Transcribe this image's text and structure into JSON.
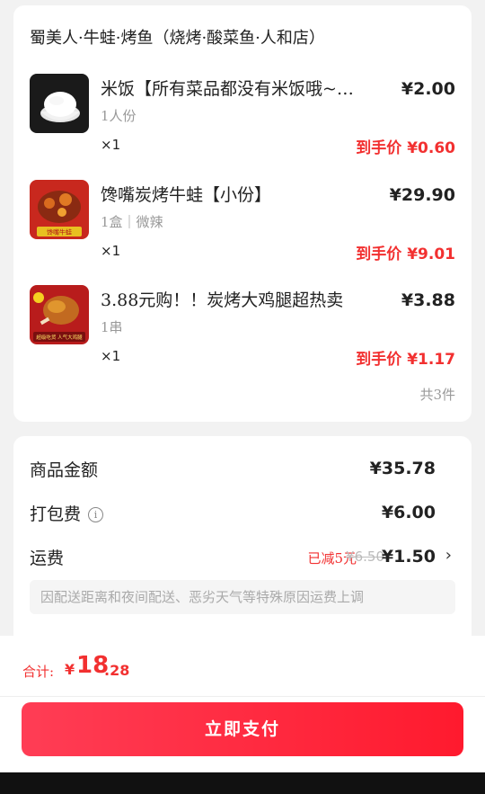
{
  "shop": {
    "name": "蜀美人·牛蛙·烤鱼（烧烤·酸菜鱼·人和店）",
    "items": [
      {
        "title": "米饭【所有菜品都没有米饭哦~…",
        "spec": "1人份",
        "price": "¥2.00",
        "qty": "×1",
        "final": "到手价 ¥0.60",
        "thumb": "rice-bowl-image"
      },
      {
        "title": "馋嘴炭烤牛蛙【小份】",
        "spec": "1盒｜微辣",
        "price": "¥29.90",
        "qty": "×1",
        "final": "到手价 ¥9.01",
        "thumb": "bullfrog-image",
        "thumb_caption": "馋嘴牛蛙"
      },
      {
        "title": "3.88元购！！炭烤大鸡腿超热卖",
        "spec": "1串",
        "price": "¥3.88",
        "qty": "×1",
        "final": "到手价 ¥1.17",
        "thumb": "chicken-leg-image",
        "thumb_caption": "超级吃货 人气大鸡腿"
      }
    ],
    "total_count": "共3件"
  },
  "fees": {
    "goods_label": "商品金额",
    "goods_value": "¥35.78",
    "package_label": "打包费",
    "package_value": "¥6.00",
    "shipping_label": "运费",
    "shipping_discount": "已减5元",
    "shipping_original": "¥6.50",
    "shipping_value": "¥1.50",
    "notice": "因配送距离和夜间配送、恶劣天气等特殊原因运费上调"
  },
  "bottom": {
    "sum_label": "合计:",
    "sum_yen": "¥",
    "sum_int": "18",
    "sum_dec": ".28",
    "pay_label": "立即支付"
  },
  "colors": {
    "accent": "#f23030",
    "button_start": "#ff3d55",
    "button_end": "#ff1a2e"
  }
}
